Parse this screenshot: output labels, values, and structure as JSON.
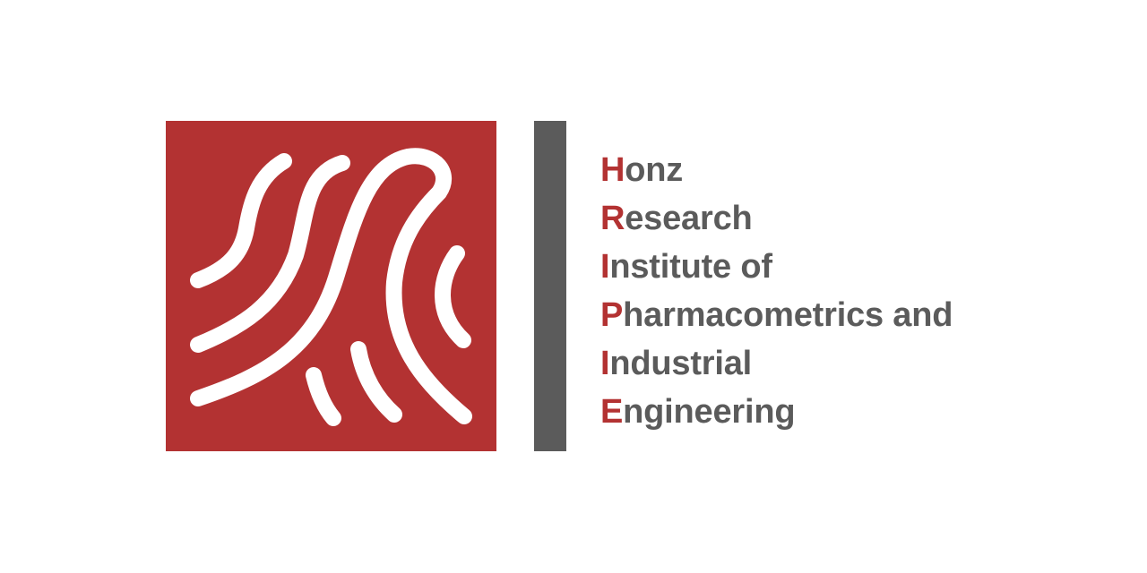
{
  "colors": {
    "brand_red": "#b33232",
    "brand_gray": "#5b5b5b",
    "stroke_white": "#ffffff",
    "background": "#ffffff"
  },
  "logo": {
    "mark_icon": "fingerprint-waves-icon",
    "lines": [
      {
        "initial": "H",
        "rest": "onz"
      },
      {
        "initial": "R",
        "rest": "esearch"
      },
      {
        "initial": "I",
        "rest": "nstitute of"
      },
      {
        "initial": "P",
        "rest": "harmacometrics and"
      },
      {
        "initial": "I",
        "rest": "ndustrial"
      },
      {
        "initial": "E",
        "rest": "ngineering"
      }
    ]
  }
}
